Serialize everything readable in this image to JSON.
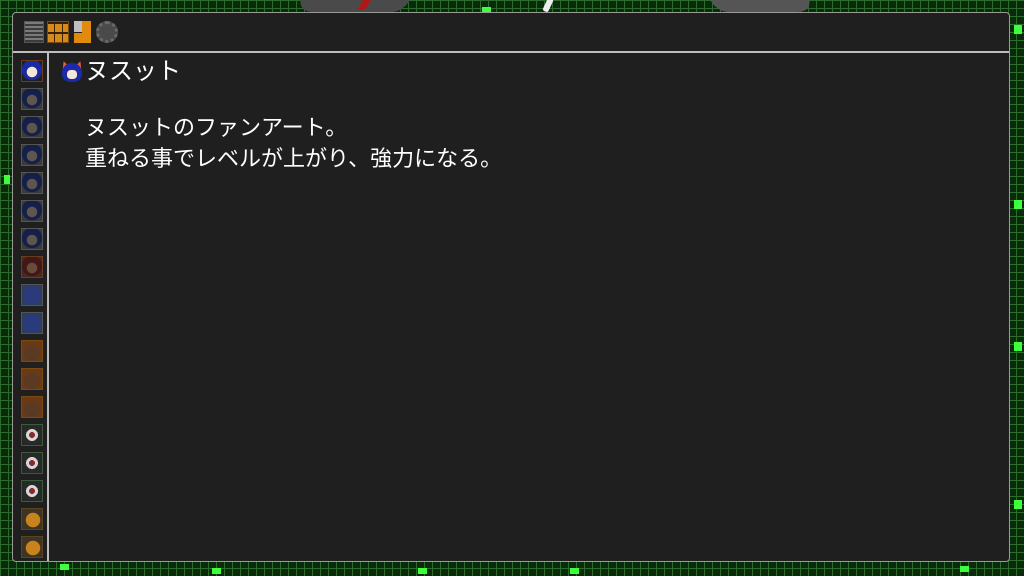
{
  "toolbar": {
    "buttons": [
      {
        "name": "list-view",
        "icon": "list-icon"
      },
      {
        "name": "grid-view",
        "icon": "grid-icon"
      },
      {
        "name": "sort",
        "icon": "sort-icon"
      },
      {
        "name": "settings",
        "icon": "gear-icon"
      }
    ]
  },
  "sidebar": {
    "items": [
      {
        "icon": "character-portrait-icon",
        "selected": true
      },
      {
        "icon": "character-portrait-icon"
      },
      {
        "icon": "character-portrait-icon"
      },
      {
        "icon": "character-portrait-icon"
      },
      {
        "icon": "character-portrait-icon"
      },
      {
        "icon": "character-portrait-icon"
      },
      {
        "icon": "character-portrait-icon"
      },
      {
        "icon": "character-portrait-icon"
      },
      {
        "icon": "character-portrait-icon"
      },
      {
        "icon": "character-portrait-icon"
      },
      {
        "icon": "character-portrait-icon"
      },
      {
        "icon": "character-portrait-icon"
      },
      {
        "icon": "character-portrait-icon"
      },
      {
        "icon": "ring-item-icon"
      },
      {
        "icon": "ring-item-icon"
      },
      {
        "icon": "ring-item-icon"
      },
      {
        "icon": "fox-item-icon"
      },
      {
        "icon": "fox-item-icon"
      }
    ]
  },
  "detail": {
    "name": "ヌスット",
    "description_line1": "ヌスットのファンアート。",
    "description_line2": "重ねる事でレベルが上がり、強力になる。"
  },
  "colors": {
    "panel": "#1f1f1f",
    "border": "#bdbdbd",
    "accent": "#e08a10",
    "grid_green": "#2b6b2b",
    "glow_green": "#3dff3d"
  }
}
